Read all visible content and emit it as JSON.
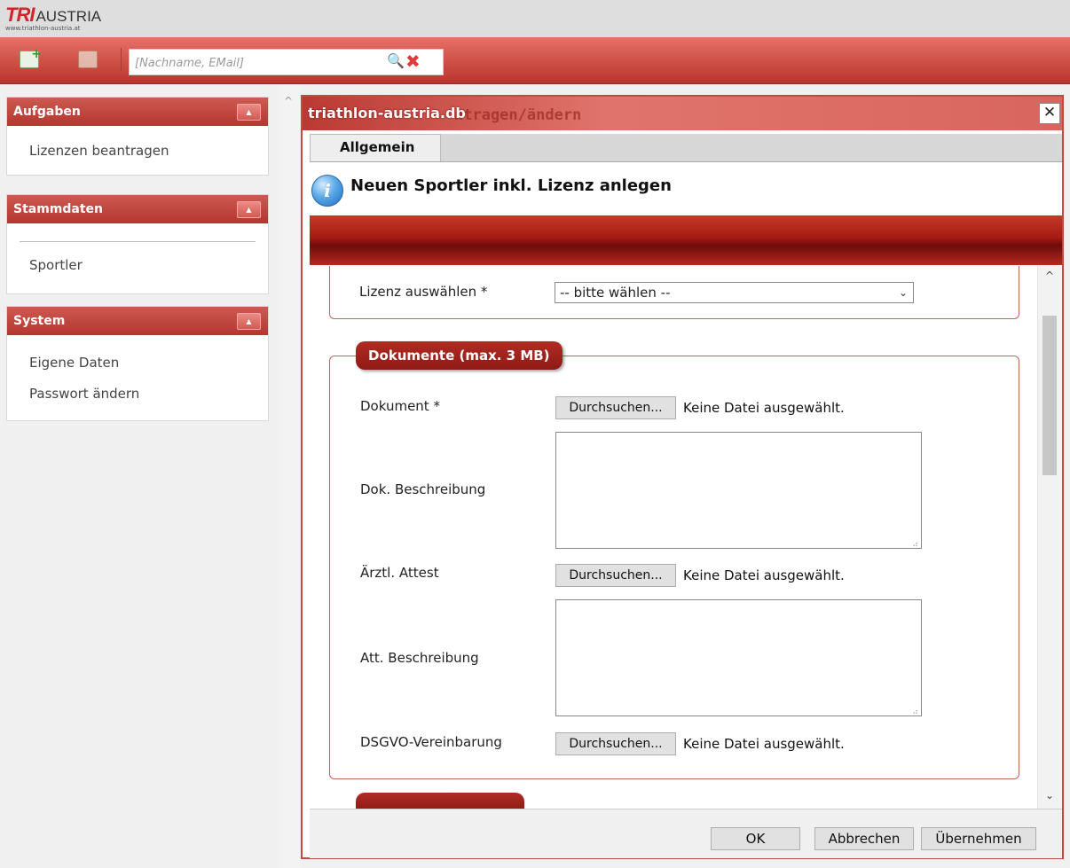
{
  "logo": {
    "brand": "TRI",
    "name": "AUSTRIA",
    "url": "www.triathlon-austria.at"
  },
  "toolbar": {
    "new_icon": "add-record-icon",
    "list_icon": "list-icon",
    "search_placeholder": "[Nachname, EMail]",
    "search_icon": "magnifier-icon",
    "clear_icon": "clear-icon"
  },
  "sidebar": {
    "panels": [
      {
        "title": "Aufgaben",
        "items": [
          "Lizenzen beantragen"
        ]
      },
      {
        "title": "Stammdaten",
        "items": [
          "Sportler"
        ]
      },
      {
        "title": "System",
        "items": [
          "Eigene Daten",
          "Passwort ändern"
        ]
      }
    ],
    "toggle_glyph": "▲"
  },
  "dialog": {
    "title": "triathlon-austria.db",
    "title_behind": "ntragen/ändern",
    "close_glyph": "✕",
    "tab": "Allgemein",
    "info_text": "Neuen Sportler inkl. Lizenz anlegen",
    "info_glyph": "i",
    "form": {
      "license_label": "Lizenz auswählen *",
      "license_value": "-- bitte wählen --",
      "documents_legend": "Dokumente (max. 3 MB)",
      "rows": {
        "doc_label": "Dokument *",
        "doc_desc_label": "Dok. Beschreibung",
        "attest_label": "Ärztl. Attest",
        "attest_desc_label": "Att. Beschreibung",
        "dsgvo_label": "DSGVO-Vereinbarung"
      },
      "browse_label": "Durchsuchen...",
      "no_file_text": "Keine Datei ausgewählt."
    },
    "buttons": {
      "ok": "OK",
      "cancel": "Abbrechen",
      "apply": "Übernehmen"
    }
  },
  "colors": {
    "accent": "#c34a41",
    "header_dark": "#b4362f",
    "legend": "#a0241d"
  }
}
